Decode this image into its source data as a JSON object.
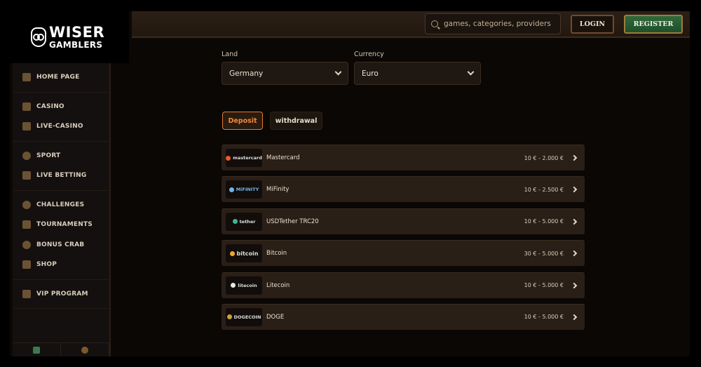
{
  "logo": {
    "line1": "WISER",
    "line2": "GAMBLERS"
  },
  "header": {
    "search_placeholder": "games, categories, providers",
    "login_label": "LOGIN",
    "register_label": "REGISTER"
  },
  "sidebar": {
    "groups": [
      {
        "items": [
          {
            "label": "HOME PAGE",
            "icon": "home-icon"
          }
        ]
      },
      {
        "items": [
          {
            "label": "CASINO",
            "icon": "slot-machine-icon"
          },
          {
            "label": "LIVE-CASINO",
            "icon": "cards-icon"
          }
        ]
      },
      {
        "items": [
          {
            "label": "SPORT",
            "icon": "soccer-ball-icon"
          },
          {
            "label": "LIVE BETTING",
            "icon": "live-icon"
          }
        ]
      },
      {
        "items": [
          {
            "label": "CHALLENGES",
            "icon": "target-icon"
          },
          {
            "label": "TOURNAMENTS",
            "icon": "trophy-icon"
          },
          {
            "label": "BONUS CRAB",
            "icon": "crab-icon"
          },
          {
            "label": "SHOP",
            "icon": "shop-icon"
          }
        ]
      },
      {
        "items": [
          {
            "label": "VIP PROGRAM",
            "icon": "diamond-icon"
          }
        ]
      }
    ]
  },
  "filters": {
    "land_label": "Land",
    "land_value": "Germany",
    "currency_label": "Currency",
    "currency_value": "Euro"
  },
  "tabs": {
    "deposit": "Deposit",
    "withdrawal": "withdrawal"
  },
  "methods": [
    {
      "name": "Mastercard",
      "range": "10 € - 2.000 €",
      "logo": "mastercard"
    },
    {
      "name": "MiFinity",
      "range": "10 € - 2.500 €",
      "logo": "MiFINITY"
    },
    {
      "name": "USDTether TRC20",
      "range": "10 € - 5.000 €",
      "logo": "tether"
    },
    {
      "name": "Bitcoin",
      "range": "30 € - 5.000 €",
      "logo": "bitcoin"
    },
    {
      "name": "Litecoin",
      "range": "10 € - 5.000 €",
      "logo": "litecoin"
    },
    {
      "name": "DOGE",
      "range": "10 € - 5.000 €",
      "logo": "DOGECOIN"
    }
  ],
  "colors": {
    "accent": "#e07a2e",
    "register": "#2f6b3b",
    "panel": "#2a1f17"
  }
}
